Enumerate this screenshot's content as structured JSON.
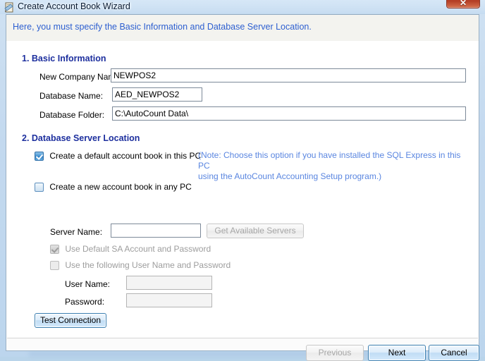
{
  "window": {
    "title": "Create Account Book Wizard",
    "icon": "wizard-document-icon",
    "close_label": "✕"
  },
  "banner": {
    "text": "Here, you must specify the Basic Information and Database Server Location."
  },
  "sections": {
    "basic_information": {
      "heading": "1. Basic Information",
      "fields": [
        {
          "label": "New Company Name:",
          "value": "NEWPOS2",
          "placeholder": ""
        },
        {
          "label": "Database Name:",
          "value": "AED_NEWPOS2",
          "placeholder": ""
        },
        {
          "label": "Database Folder:",
          "value": "C:\\AutoCount Data\\",
          "placeholder": ""
        }
      ]
    },
    "database_server_location": {
      "heading": "2. Database Server Location",
      "default_book": {
        "label": "Create a default account book in this PC",
        "checked": true,
        "note_line1": "(Note: Choose this option if you have installed the SQL Express in this PC",
        "note_line2": "using the AutoCount Accounting Setup program.)"
      },
      "new_book_any_pc": {
        "label": "Create a new account book in any PC",
        "checked": false
      },
      "server_name": {
        "label": "Server Name:",
        "value": "",
        "placeholder": ""
      },
      "get_available_servers_button": "Get Available Servers",
      "use_default_sa": {
        "label": "Use Default SA Account and Password",
        "checked": true
      },
      "use_following_credentials": {
        "label": "Use the following User Name and Password",
        "checked": false
      },
      "user_name": {
        "label": "User Name:",
        "value": "",
        "placeholder": ""
      },
      "password": {
        "label": "Password:",
        "value": "",
        "placeholder": ""
      },
      "test_connection_button": "Test Connection"
    }
  },
  "footer": {
    "previous_label": "Previous",
    "next_label": "Next",
    "cancel_label": "Cancel"
  },
  "colors": {
    "heading_blue": "#1d2f9e",
    "banner_text_blue": "#2d5fd0",
    "note_blue": "#5a86e0",
    "accent_button_border": "#3c7fb1",
    "close_button_red": "#c0452c",
    "disabled_text": "#a6a6a6"
  }
}
